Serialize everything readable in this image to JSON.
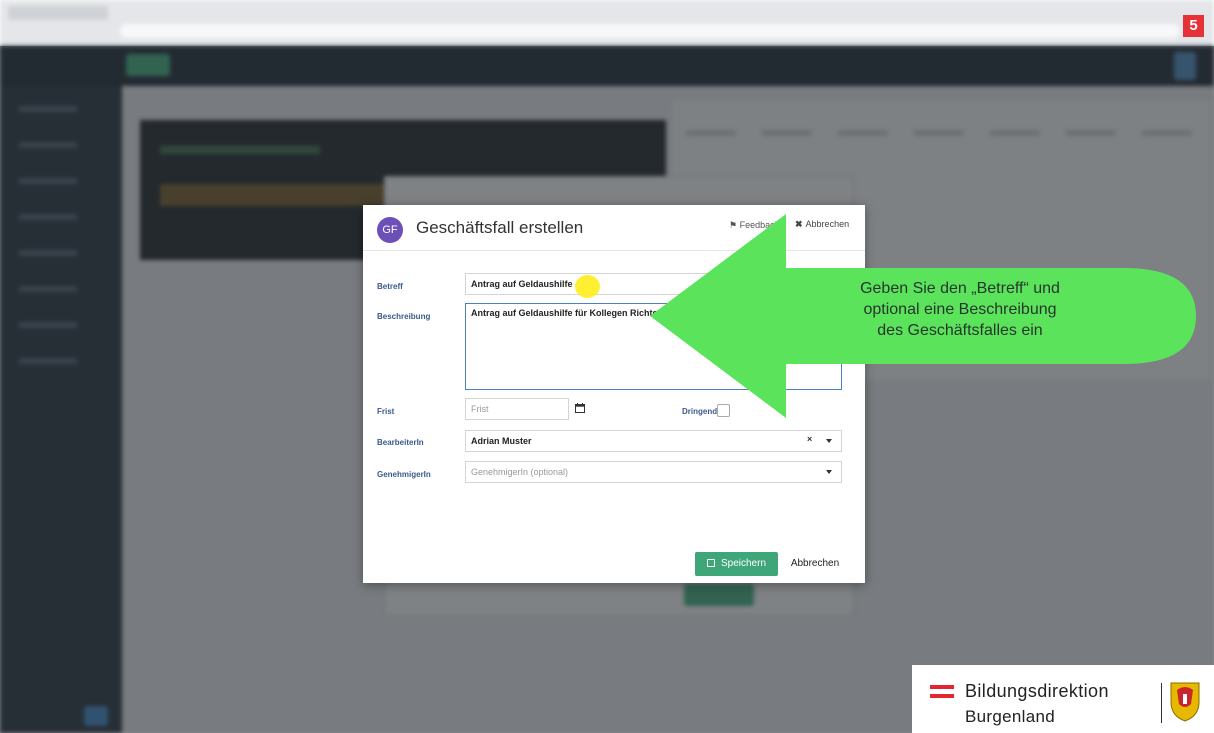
{
  "step_badge": "5",
  "modal": {
    "avatar_initials": "GF",
    "title": "Geschäftsfall erstellen",
    "feedback_label": "Feedback",
    "cancel_label": "Abbrechen",
    "fields": {
      "betreff": {
        "label": "Betreff",
        "value": "Antrag auf Geldaushilfe"
      },
      "beschreibung": {
        "label": "Beschreibung",
        "value": "Antrag auf Geldaushilfe für Kollegen Richter D"
      },
      "frist": {
        "label": "Frist",
        "placeholder": "Frist",
        "icon": "calendar-icon"
      },
      "dringend": {
        "label": "Dringend",
        "checked": false
      },
      "bearbeiterin": {
        "label": "BearbeiterIn",
        "value": "Adrian Muster",
        "clear": "×"
      },
      "genehmigerin": {
        "label": "GenehmigerIn",
        "placeholder": "GenehmigerIn (optional)"
      }
    },
    "save_label": "Speichern",
    "abort_label": "Abbrechen"
  },
  "callout": {
    "line1": "Geben Sie den „Betreff“ und",
    "line2": "optional eine Beschreibung",
    "line3": "des Geschäftsfalles ein",
    "color": "#5ce35c"
  },
  "logo": {
    "line1": "Bildungsdirektion",
    "line2": "Burgenland"
  },
  "colors": {
    "accent_green": "#3fa67a",
    "avatar_purple": "#6c4fb7",
    "badge_red": "#e53238"
  }
}
